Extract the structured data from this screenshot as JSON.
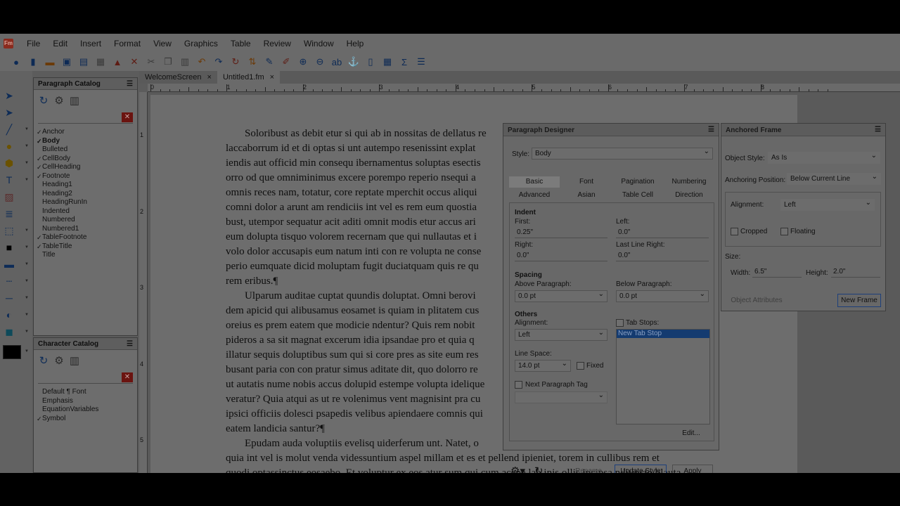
{
  "menu": [
    "File",
    "Edit",
    "Insert",
    "Format",
    "View",
    "Graphics",
    "Table",
    "Review",
    "Window",
    "Help"
  ],
  "app_logo_text": "Fm",
  "toolbar": {
    "icons": [
      "help-icon",
      "new-document-icon",
      "open-folder-icon",
      "save-icon",
      "save-all-icon",
      "print-icon",
      "lock-icon",
      "cut-icon",
      "scissors-icon",
      "copy-icon",
      "paste-icon",
      "undo-icon",
      "redo-icon",
      "repeat-icon",
      "sort-icon",
      "paint-format-icon",
      "paint-swap-icon",
      "zoom-in-icon",
      "zoom-out-icon",
      "spell-check-icon",
      "anchor-icon",
      "page-icon",
      "table-icon",
      "sigma-icon",
      "list-icon"
    ]
  },
  "paragraph_catalog": {
    "title": "Paragraph Catalog",
    "items": [
      {
        "label": "Anchor",
        "checked": true,
        "bold": false
      },
      {
        "label": "Body",
        "checked": true,
        "bold": true
      },
      {
        "label": "Bulleted",
        "checked": false,
        "bold": false
      },
      {
        "label": "CellBody",
        "checked": true,
        "bold": false
      },
      {
        "label": "CellHeading",
        "checked": true,
        "bold": false
      },
      {
        "label": "Footnote",
        "checked": true,
        "bold": false
      },
      {
        "label": "Heading1",
        "checked": false,
        "bold": false
      },
      {
        "label": "Heading2",
        "checked": false,
        "bold": false
      },
      {
        "label": "HeadingRunIn",
        "checked": false,
        "bold": false
      },
      {
        "label": "Indented",
        "checked": false,
        "bold": false
      },
      {
        "label": "Numbered",
        "checked": false,
        "bold": false
      },
      {
        "label": "Numbered1",
        "checked": false,
        "bold": false
      },
      {
        "label": "TableFootnote",
        "checked": true,
        "bold": false
      },
      {
        "label": "TableTitle",
        "checked": true,
        "bold": false
      },
      {
        "label": "Title",
        "checked": false,
        "bold": false
      }
    ]
  },
  "character_catalog": {
    "title": "Character Catalog",
    "items": [
      {
        "label": "Default ¶ Font",
        "checked": false
      },
      {
        "label": "Emphasis",
        "checked": false
      },
      {
        "label": "EquationVariables",
        "checked": false
      },
      {
        "label": "Symbol",
        "checked": true
      }
    ]
  },
  "doc_tabs": [
    {
      "label": "WelcomeScreen",
      "active": false
    },
    {
      "label": "Untitled1.fm",
      "active": true
    }
  ],
  "ruler": {
    "h_numbers": [
      "0",
      "1",
      "2",
      "3",
      "4",
      "5",
      "6",
      "7",
      "8"
    ],
    "v_numbers": [
      "1",
      "2",
      "3",
      "4",
      "5"
    ]
  },
  "document": {
    "lines": [
      {
        "text": "Soloribust as debit etur si qui ab in nossitas de dellatus re",
        "indent": true
      },
      {
        "text": "laccaborrum id et di optas si unt autempo resenissint explat",
        "indent": false
      },
      {
        "text": "iendis aut officid min consequ ibernamentus soluptas esectis",
        "indent": false
      },
      {
        "text": "orro od que omniminimus excere porempo reperio nsequi a",
        "indent": false
      },
      {
        "text": "omnis reces nam, totatur, core reptate mperchit occus aliqui",
        "indent": false
      },
      {
        "text": "comni dolor a arunt am rendiciis int vel es rem eum quostia",
        "indent": false
      },
      {
        "text": "bust, utempor sequatur acit aditi omnit modis etur accus ari",
        "indent": false
      },
      {
        "text": "eum dolupta tisquo volorem recernam que qui nullautas et i",
        "indent": false
      },
      {
        "text": "volo dolor accusapis eum natum inti con re volupta ne conse",
        "indent": false
      },
      {
        "text": "perio eumquate dicid moluptam fugit duciatquam quis re qu",
        "indent": false
      },
      {
        "text": "rem eribus.¶",
        "indent": false
      },
      {
        "text": "Ulparum auditae cuptat quundis doluptat. Omni berovi",
        "indent": true
      },
      {
        "text": "dem apicid qui alibusamus eosamet is quiam in plitatem cus",
        "indent": false
      },
      {
        "text": "oreius es prem eatem que modicie ndentur? Quis rem nobit",
        "indent": false
      },
      {
        "text": "pideros a sa sit magnat excerum idia ipsandae pro et quia q",
        "indent": false
      },
      {
        "text": "illatur sequis doluptibus sum qui si core pres as site eum res",
        "indent": false
      },
      {
        "text": "busant paria con con pratur simus aditate dit, quo dolorro re",
        "indent": false
      },
      {
        "text": "ut autatis nume nobis accus dolupid estempe volupta idelique",
        "indent": false
      },
      {
        "text": "veratur? Quia atqui as ut re volenimus vent magnisint pra cu",
        "indent": false
      },
      {
        "text": "ipsici officiis dolesci psapedis velibus apiendaere comnis qui",
        "indent": false
      },
      {
        "text": "eatem landicia santur?¶",
        "indent": false
      },
      {
        "text": "Epudam auda voluptiis evelisq uiderferum unt. Natet, o",
        "indent": true
      },
      {
        "text": "quia int vel is molut venda videssuntium aspel millam et es et pellend ipieniet, torem in cullibus rem et",
        "indent": false
      },
      {
        "text": "quodi optassinctus eosaebo. Et voluptur ex eos atur sum qui cum acepe lab inis ollis incipsa nditincto blauta",
        "indent": false
      }
    ]
  },
  "paragraph_designer": {
    "title": "Paragraph Designer",
    "style_label": "Style:",
    "style_value": "Body",
    "tabs_row1": [
      "Basic",
      "Font",
      "Pagination",
      "Numbering"
    ],
    "tabs_row2": [
      "Advanced",
      "Asian",
      "Table Cell",
      "Direction"
    ],
    "active_tab": "Basic",
    "indent": {
      "heading": "Indent",
      "first_label": "First:",
      "first_value": "0.25\"",
      "left_label": "Left:",
      "left_value": "0.0\"",
      "right_label": "Right:",
      "right_value": "0.0\"",
      "last_line_right_label": "Last Line Right:",
      "last_line_right_value": "0.0\""
    },
    "spacing": {
      "heading": "Spacing",
      "above_label": "Above Paragraph:",
      "above_value": "0.0 pt",
      "below_label": "Below Paragraph:",
      "below_value": "0.0 pt"
    },
    "others": {
      "heading": "Others",
      "alignment_label": "Alignment:",
      "alignment_value": "Left",
      "tab_stops_label": "Tab Stops:",
      "tab_stop_item": "New Tab Stop",
      "line_space_label": "Line Space:",
      "line_space_value": "14.0 pt",
      "fixed_label": "Fixed",
      "next_tag_label": "Next Paragraph Tag",
      "edit_label": "Edit..."
    },
    "buttons": {
      "rename": "Rename",
      "update": "Update Style",
      "apply": "Apply"
    }
  },
  "anchored_frame": {
    "title": "Anchored Frame",
    "object_style_label": "Object Style:",
    "object_style_value": "As Is",
    "anchoring_label": "Anchoring Position:",
    "anchoring_value": "Below Current Line",
    "alignment_label": "Alignment:",
    "alignment_value": "Left",
    "cropped_label": "Cropped",
    "floating_label": "Floating",
    "size_label": "Size:",
    "width_label": "Width:",
    "width_value": "6.5\"",
    "height_label": "Height:",
    "height_value": "2.0\"",
    "object_attributes_label": "Object Attributes",
    "new_frame_label": "New Frame"
  }
}
